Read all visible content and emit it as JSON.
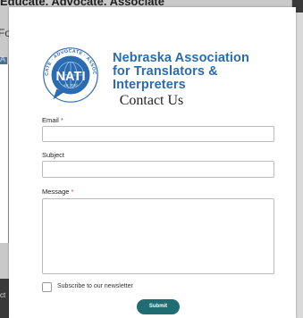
{
  "background": {
    "heading": "Educate. Advocate. Associate",
    "fo_text": "Fo",
    "tab_text": "A",
    "dark_text": "ct"
  },
  "modal": {
    "logo": {
      "seal_text": "NATI",
      "seal_year": "est. 2010",
      "ring_text": "EDUCATE · ADVOCATE · ASSOCIATE",
      "org_name_line1": "Nebraska Association",
      "org_name_line2": "for Translators & Interpreters"
    },
    "title": "Contact Us",
    "fields": {
      "email_label": "Email",
      "subject_label": "Subject",
      "message_label": "Message",
      "required_marker": "*"
    },
    "newsletter_label": "Subscribe to our newsletter",
    "submit_label": "Submit"
  },
  "colors": {
    "brand_blue": "#2a6bb1",
    "submit_teal": "#1f6c73",
    "required_red": "#cc3333"
  }
}
